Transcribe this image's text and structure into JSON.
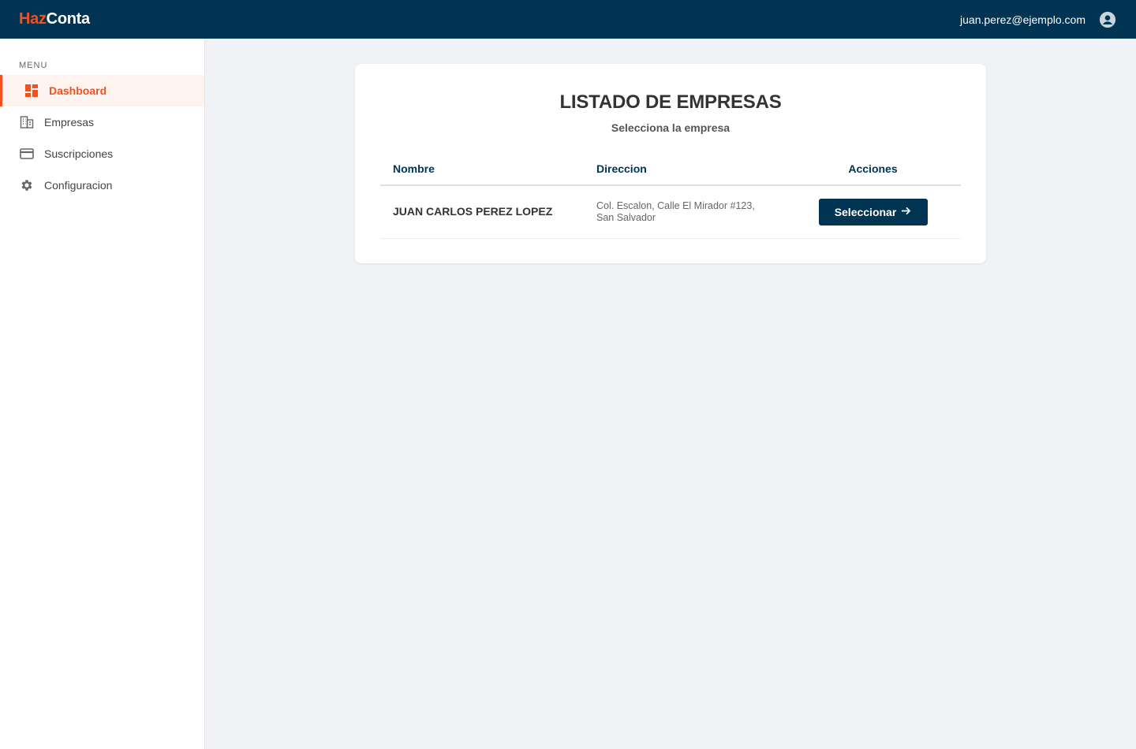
{
  "header": {
    "logo_part1": "Haz",
    "logo_part2": "Conta",
    "user_email": "juan.perez@ejemplo.com",
    "user_icon": "account-circle-icon"
  },
  "sidebar": {
    "menu_caption": "MENU",
    "items": [
      {
        "label": "Dashboard",
        "icon": "dashboard-icon",
        "active": true
      },
      {
        "label": "Empresas",
        "icon": "building-icon",
        "active": false
      },
      {
        "label": "Suscripciones",
        "icon": "credit-card-icon",
        "active": false
      },
      {
        "label": "Configuracion",
        "icon": "gear-icon",
        "active": false
      }
    ]
  },
  "main": {
    "title": "LISTADO DE EMPRESAS",
    "subtitle": "Selecciona la empresa",
    "table": {
      "columns": [
        "Nombre",
        "Direccion",
        "Acciones"
      ],
      "rows": [
        {
          "nombre": "JUAN CARLOS PEREZ LOPEZ",
          "direccion_line1": "Col. Escalon, Calle El Mirador #123,",
          "direccion_line2": "San Salvador",
          "action_label": "Seleccionar",
          "action_icon": "arrow-right-icon"
        }
      ]
    }
  },
  "colors": {
    "primary": "#003452",
    "accent": "#f4511e",
    "background": "#f0f2f5"
  }
}
